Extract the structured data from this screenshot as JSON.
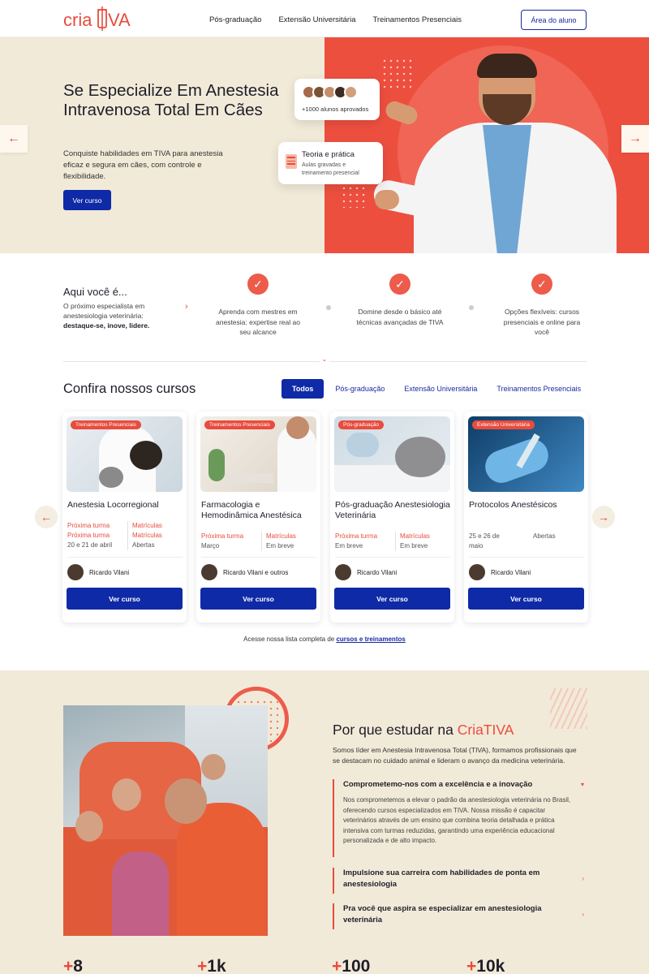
{
  "header": {
    "logo": "CriaTIVA",
    "nav": [
      "Pós-graduação",
      "Extensão Universitária",
      "Treinamentos Presenciais"
    ],
    "student_area": "Área do aluno"
  },
  "hero": {
    "title": "Se Especialize Em Anestesia Intravenosa Total Em Cães",
    "description": "Conquiste habilidades em TIVA para anestesia eficaz e segura em cães, com controle e flexibilidade.",
    "cta": "Ver curso",
    "badge_approved": "+1000 alunos aprovados",
    "badge_theory_title": "Teoria e prática",
    "badge_theory_text": "Aulas gravadas e treinamento presencial",
    "prev_arrow": "←",
    "next_arrow": "→"
  },
  "features": {
    "title": "Aqui você é...",
    "description": "O próximo especialista em anestesiologia veterinária:",
    "highlight": "destaque-se, inove, lidere.",
    "items": [
      {
        "icon": "check-icon",
        "text": "Aprenda com mestres em anestesia: expertise real ao seu alcance"
      },
      {
        "icon": "check-icon",
        "text": "Domine desde o básico até técnicas avançadas de TIVA"
      },
      {
        "icon": "check-icon",
        "text": "Opções flexíveis: cursos presenciais e online para você"
      }
    ]
  },
  "courses": {
    "title": "Confira nossos cursos",
    "filters": [
      "Todos",
      "Pós-graduação",
      "Extensão Universitária",
      "Treinamentos Presenciais"
    ],
    "active_filter": "Todos",
    "cards": [
      {
        "tag": "Treinamentos Presenciais",
        "name": "Anestesia Locorregional",
        "l1a": "Próxima turma",
        "l1b": "Matrículas",
        "l2a": "Próxima turma",
        "l2b": "Matrículas",
        "l3a": "20 e 21 de abril",
        "l3b": "Abertas",
        "instructor": "Ricardo Vilani",
        "cta": "Ver curso"
      },
      {
        "tag": "Treinamentos Presenciais",
        "name": "Farmacologia e Hemodinâmica Anestésica",
        "l1a": "Próxima turma",
        "l1b": "Matrículas",
        "l2a": "Março",
        "l2b": "Em breve",
        "instructor": "Ricardo Vilani e outros",
        "cta": "Ver curso"
      },
      {
        "tag": "Pós-graduação",
        "name": "Pós-graduação Anestesiologia Veterinária",
        "l1a": "Próxima turma",
        "l1b": "Matrículas",
        "l2a": "Em breve",
        "l2b": "Em breve",
        "instructor": "Ricardo Vilani",
        "cta": "Ver curso"
      },
      {
        "tag": "Extensão Universitária",
        "name": "Protocolos Anestésicos",
        "l1a": "25 e 26 de maio",
        "l1b": "Abertas",
        "instructor": "Ricardo Vilani",
        "cta": "Ver curso"
      }
    ],
    "full_list_prefix": "Acesse nossa lista completa de",
    "full_list_link": "cursos e treinamentos"
  },
  "why": {
    "title_prefix": "Por que estudar na",
    "title_brand": "CriaTIVA",
    "description": "Somos líder em Anestesia Intravenosa Total (TIVA), formamos profissionais que se destacam no cuidado animal e lideram o avanço da medicina veterinária.",
    "accordion": [
      {
        "title": "Comprometemo-nos com a excelência e a inovação",
        "body": "Nos comprometemos a elevar o padrão da anestesiologia veterinária no Brasil, oferecendo cursos especializados em TIVA. Nossa missão é capacitar veterinários através de um ensino que combina teoria detalhada e prática intensiva com turmas reduzidas, garantindo uma experiência educacional personalizada e de alto impacto."
      },
      {
        "title": "Impulsione sua carreira com habilidades de ponta em anestesiologia",
        "body": ""
      },
      {
        "title": "Pra você que aspira se especializar em anestesiologia veterinária",
        "body": ""
      }
    ]
  },
  "stats": [
    {
      "prefix": "+",
      "value": "8"
    },
    {
      "prefix": "+",
      "value": "1k"
    },
    {
      "prefix": "+",
      "value": "100"
    },
    {
      "prefix": "+",
      "value": "10k"
    }
  ],
  "colors": {
    "brand_red": "#e84c3d",
    "brand_blue": "#0f2aa6",
    "cream": "#f2ead8"
  }
}
